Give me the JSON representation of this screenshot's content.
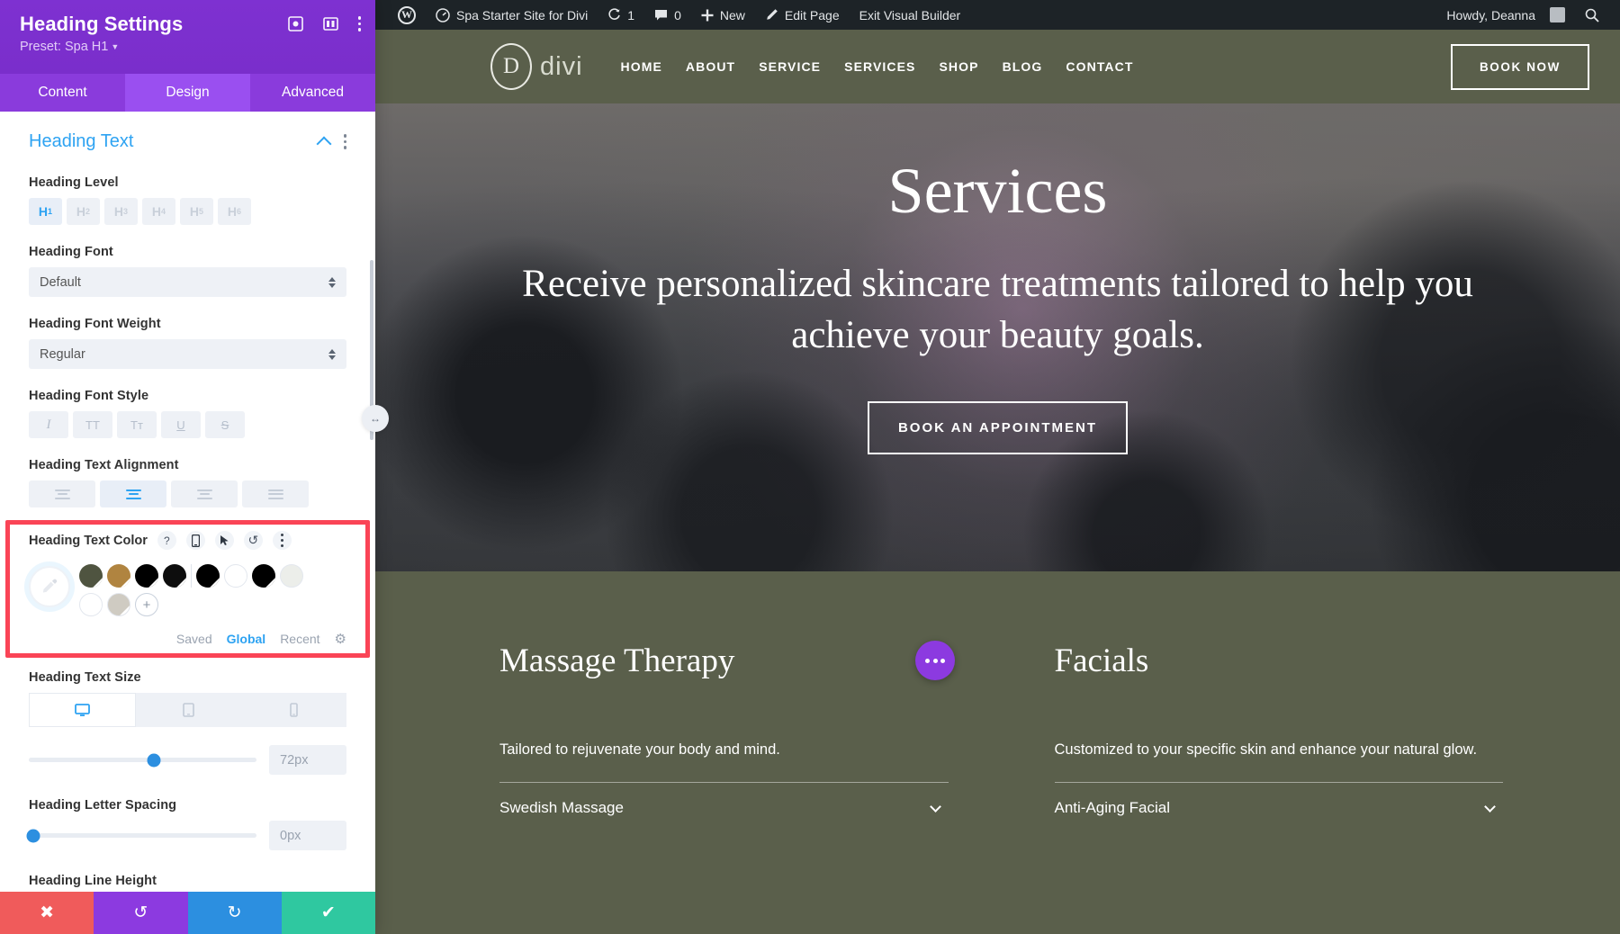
{
  "panel": {
    "title": "Heading Settings",
    "preset_label": "Preset: Spa H1",
    "head_icons": [
      {
        "name": "focus-target-icon",
        "glyph": "☉"
      },
      {
        "name": "layout-columns-icon",
        "glyph": "▤"
      }
    ],
    "tabs": [
      {
        "label": "Content",
        "active": false
      },
      {
        "label": "Design",
        "active": true
      },
      {
        "label": "Advanced",
        "active": false
      }
    ],
    "section": {
      "title": "Heading Text"
    },
    "heading_level": {
      "label": "Heading Level",
      "options": [
        "H1",
        "H2",
        "H3",
        "H4",
        "H5",
        "H6"
      ],
      "selected": "H1"
    },
    "heading_font": {
      "label": "Heading Font",
      "value": "Default"
    },
    "heading_font_weight": {
      "label": "Heading Font Weight",
      "value": "Regular"
    },
    "heading_font_style": {
      "label": "Heading Font Style",
      "options": [
        {
          "name": "italic-icon",
          "glyph": "I"
        },
        {
          "name": "uppercase-icon",
          "glyph": "TT"
        },
        {
          "name": "small-caps-icon",
          "glyph": "Tт"
        },
        {
          "name": "underline-icon",
          "glyph": "U"
        },
        {
          "name": "strikethrough-icon",
          "glyph": "S"
        }
      ]
    },
    "heading_text_alignment": {
      "label": "Heading Text Alignment",
      "options": [
        "left",
        "center",
        "right",
        "justify"
      ],
      "selected": "center"
    },
    "heading_text_color": {
      "label": "Heading Text Color",
      "mini_icons": [
        {
          "name": "help-icon",
          "glyph": "?"
        },
        {
          "name": "responsive-phone-icon",
          "glyph": "▯"
        },
        {
          "name": "hover-cursor-icon",
          "glyph": "↖"
        },
        {
          "name": "reset-icon",
          "glyph": "↺"
        },
        {
          "name": "more-options-icon",
          "glyph": "⋮"
        }
      ],
      "swatches": [
        "#4f5440",
        "#b08440",
        "#000000",
        "#0d0d0d",
        "#000000",
        "#ffffff",
        "#000000",
        "#eceeea",
        "#ffffff",
        "#cfcbc2"
      ],
      "add_label": "+",
      "tabs": [
        {
          "label": "Saved",
          "active": false
        },
        {
          "label": "Global",
          "active": true
        },
        {
          "label": "Recent",
          "active": false
        }
      ],
      "settings_icon": "gear-icon"
    },
    "heading_text_size": {
      "label": "Heading Text Size",
      "devices": [
        {
          "name": "desktop-icon",
          "active": true
        },
        {
          "name": "tablet-icon",
          "active": false
        },
        {
          "name": "phone-icon",
          "active": false
        }
      ],
      "value": "72px",
      "slider_percent": 55
    },
    "heading_letter_spacing": {
      "label": "Heading Letter Spacing",
      "value": "0px",
      "slider_percent": 2
    },
    "heading_line_height": {
      "label": "Heading Line Height"
    },
    "footer": [
      {
        "name": "cancel-button",
        "glyph": "✖"
      },
      {
        "name": "undo-button",
        "glyph": "↺"
      },
      {
        "name": "redo-button",
        "glyph": "↻"
      },
      {
        "name": "save-button",
        "glyph": "✔"
      }
    ],
    "drag_handle_glyph": "↔"
  },
  "adminbar": {
    "logo": "W",
    "site_name": "Spa Starter Site for Divi",
    "updates_count": "1",
    "comments_count": "0",
    "new_label": "New",
    "edit_page_label": "Edit Page",
    "exit_builder_label": "Exit Visual Builder",
    "howdy": "Howdy, Deanna",
    "search_icon": "search-icon"
  },
  "sitenav": {
    "logo_letter": "D",
    "logo_text": "divi",
    "menu": [
      "HOME",
      "ABOUT",
      "SERVICE",
      "SERVICES",
      "SHOP",
      "BLOG",
      "CONTACT"
    ],
    "cta": "BOOK NOW"
  },
  "hero": {
    "title": "Services",
    "subtitle": "Receive personalized skincare treatments tailored to help you achieve your beauty goals.",
    "button": "BOOK AN APPOINTMENT"
  },
  "lower": {
    "columns": [
      {
        "title": "Massage Therapy",
        "desc": "Tailored to rejuvenate your body and mind.",
        "accordion": "Swedish Massage"
      },
      {
        "title": "Facials",
        "desc": "Customized to your specific skin and enhance your natural glow.",
        "accordion": "Anti-Aging Facial"
      }
    ]
  },
  "colors": {
    "purple": "#7b2fce",
    "accent_blue": "#2ea3f2",
    "highlight_red": "#fa4456",
    "site_green": "#5a5f4b"
  }
}
